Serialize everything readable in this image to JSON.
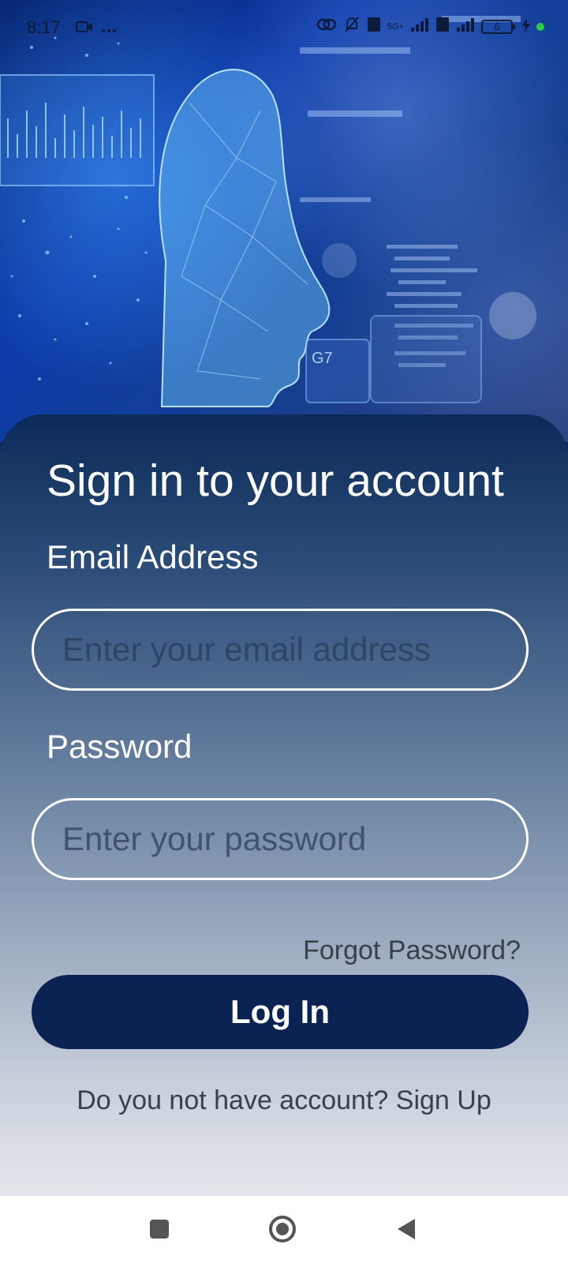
{
  "status_bar": {
    "time": "8:17",
    "network_label": "5G+",
    "battery_level": "6",
    "icons": [
      "video-icon",
      "more-icon",
      "link-icon",
      "bell-off-icon",
      "volte-icon",
      "signal-icon",
      "battery-icon",
      "charging-icon"
    ]
  },
  "login": {
    "title": "Sign in to your account",
    "email_label": "Email Address",
    "email_placeholder": "Enter your email address",
    "password_label": "Password",
    "password_placeholder": "Enter your password",
    "forgot_password": "Forgot Password?",
    "login_button": "Log In",
    "signup_prompt": "Do you not have account?",
    "signup_link": "Sign Up"
  },
  "hero": {
    "label": "G7"
  },
  "colors": {
    "button_bg": "#0b2352",
    "card_top": "#0b2a59",
    "card_bottom": "#e2e5ea"
  },
  "nav_bar": {
    "icons": [
      "recents-icon",
      "home-icon",
      "back-icon"
    ]
  }
}
